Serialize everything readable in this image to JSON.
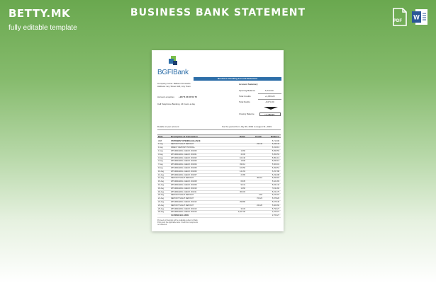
{
  "banner": {
    "brand": "BETTY.MK",
    "tagline": "fully editable template",
    "title": "BUSINESS BANK STATEMENT",
    "formats": [
      {
        "icon": "pdf-file-icon",
        "label": "PDF",
        "color": "#ffffff"
      },
      {
        "icon": "word-file-icon",
        "label": "W",
        "color": "#2b5797"
      }
    ]
  },
  "document": {
    "bank_name": "BGFIBank",
    "statement_title": "Business Checking Account Statement",
    "company_label": "Company name: Balloon Fireworks",
    "address_label": "Address: Any Street 123, Any Town",
    "enquiries_label": "Account enquiries",
    "phone": "+237 6 33 60 52 70",
    "telephone_banking": "Call Telephone Banking, 24 hours a day",
    "summary_title": "Account Summary",
    "summary": [
      {
        "label": "Opening Balance",
        "value": "5,713.00"
      },
      {
        "label": "Total Credits",
        "value": "+1,893.20"
      },
      {
        "label": "Total Debits",
        "value": "-9,073.20"
      }
    ],
    "closing_label": "Closing Balance",
    "closing_value": "= 2,763.27",
    "details_label": "Details of your account",
    "period_label": "For the period from July 30, 2019 to August 31, 2019",
    "columns": [
      "Date",
      "Description of Transaction",
      "Debit",
      "Credit",
      "Balance"
    ],
    "transactions": [
      {
        "date": "30/8",
        "desc": "STATEMENT OPENING BALANCE",
        "debit": "",
        "credit": "",
        "bal": "5,713.00"
      },
      {
        "date": "1 Aug",
        "desc": "DEPOSIT NIGHT DEPOSIT",
        "debit": "",
        "credit": "233.43",
        "bal": "5,946.43"
      },
      {
        "date": "1 Aug",
        "desc": "DIRECT DEPOSIT PAYROLL",
        "debit": "",
        "credit": "",
        "bal": "6,016.13"
      },
      {
        "date": "1 Aug",
        "desc": "WITHDRAWAL CHECK 201000",
        "debit": "19.60",
        "credit": "",
        "bal": "5,996.53"
      },
      {
        "date": "3 Aug",
        "desc": "WITHDRAWAL CHECK 201001",
        "debit": "43.00",
        "credit": "",
        "bal": "5,953.53"
      },
      {
        "date": "4 Aug",
        "desc": "WITHDRAWAL CHECK 201002",
        "debit": "102.40",
        "credit": "",
        "bal": "5,851.13"
      },
      {
        "date": "4 Aug",
        "desc": "WITHDRAWAL CHECK 201003",
        "debit": "18.00",
        "credit": "",
        "bal": "5,833.13"
      },
      {
        "date": "7 Aug",
        "desc": "WITHDRAWAL CHECK 201004",
        "debit": "333.12",
        "credit": "",
        "bal": "5,500.01"
      },
      {
        "date": "9 Aug",
        "desc": "WITHDRAWAL CHECK 201005",
        "debit": "100.50",
        "credit": "",
        "bal": "5,399.51"
      },
      {
        "date": "10 Aug",
        "desc": "WITHDRAWAL CHECK 201006",
        "debit": "141.63",
        "credit": "",
        "bal": "5,257.88"
      },
      {
        "date": "13 Aug",
        "desc": "WITHDRAWAL CHECK 201007",
        "debit": "23.80",
        "credit": "",
        "bal": "5,234.08"
      },
      {
        "date": "13 Aug",
        "desc": "DEPOSIT NIGHT DEPOSIT",
        "debit": "",
        "credit": "456.10",
        "bal": "5,690.18"
      },
      {
        "date": "15 Aug",
        "desc": "WITHDRAWAL CHECK 201008",
        "debit": "68.35",
        "credit": "",
        "bal": "5,621.83"
      },
      {
        "date": "16 Aug",
        "desc": "WITHDRAWAL CHECK 201009",
        "debit": "90.41",
        "credit": "",
        "bal": "5,531.42"
      },
      {
        "date": "18 Aug",
        "desc": "WITHDRAWAL CHECK 201010",
        "debit": "19.60",
        "credit": "",
        "bal": "5,511.82"
      },
      {
        "date": "18 Aug",
        "desc": "WITHDRAWAL CHECK 201011",
        "debit": "360.03",
        "credit": "",
        "bal": "5,151.79"
      },
      {
        "date": "20 Aug",
        "desc": "DEPOSIT NIGHT DEPOSIT",
        "debit": "",
        "credit": "3.18",
        "bal": "5,154.97"
      },
      {
        "date": "21 Aug",
        "desc": "DEPOSIT NIGHT DEPOSIT",
        "debit": "",
        "credit": "723.23",
        "bal": "5,878.20"
      },
      {
        "date": "22 Aug",
        "desc": "WITHDRAWAL CHECK 201012",
        "debit": "298.80",
        "credit": "",
        "bal": "5,579.40"
      },
      {
        "date": "23 Aug",
        "desc": "DEPOSIT NIGHT DEPOSIT",
        "debit": "",
        "credit": "244.20",
        "bal": "5,823.60"
      },
      {
        "date": "25 Aug",
        "desc": "WITHDRAWAL CHECK 201013",
        "debit": "33.33",
        "credit": "",
        "bal": "5,790.27"
      },
      {
        "date": "26 Aug",
        "desc": "WITHDRAWAL CHECK 201014",
        "debit": "3,027.00",
        "credit": "",
        "bal": "2,763.27"
      },
      {
        "date": "",
        "desc": "CLOSING BALANCE",
        "debit": "",
        "credit": "",
        "bal": "2,763.27"
      }
    ],
    "footer_note": "Proceeds of deposits will be available subject to Bank Policy and the applicable laws. Credit line repayments not reflected."
  }
}
